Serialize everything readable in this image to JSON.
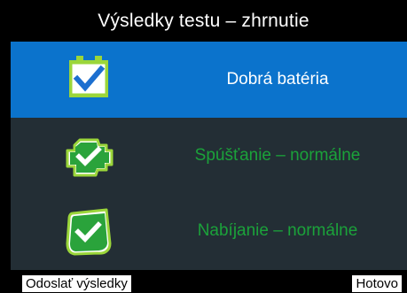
{
  "window": {
    "title": "Výsledky testu – zhrnutie"
  },
  "results": [
    {
      "icon": "battery-check-icon",
      "label": "Dobrá batéria",
      "selected": true
    },
    {
      "icon": "engine-check-icon",
      "label": "Spúšťanie – normálne",
      "selected": false
    },
    {
      "icon": "alternator-check-icon",
      "label": "Nabíjanie – normálne",
      "selected": false
    }
  ],
  "footer": {
    "send_label": "Odoslať výsledky",
    "done_label": "Hotovo"
  },
  "colors": {
    "background": "#000000",
    "panel": "#232e35",
    "selected_row": "#0b73cc",
    "ok_green": "#1ba23a",
    "check_blue": "#1c6fd0"
  }
}
